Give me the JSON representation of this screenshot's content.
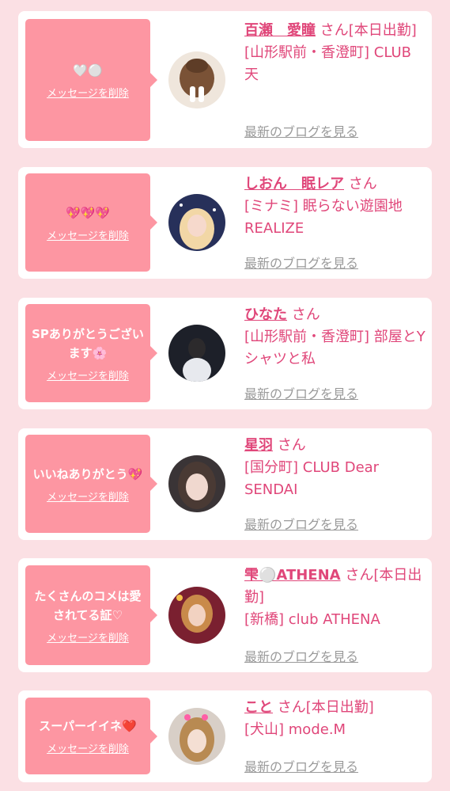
{
  "delete_label": "メッセージを削除",
  "blog_label": "最新のブログを見る",
  "colors": {
    "accent": "#e0477a",
    "bubble": "#fd96a2",
    "background": "#fbe0e4"
  },
  "cards": [
    {
      "message": "🤍⚪️",
      "name": "百瀬　愛瞳",
      "suffix": "さん[本日出勤]",
      "shop": "[山形駅前・香澄町] CLUB 天",
      "avatar_icon": "avatar-photo"
    },
    {
      "message": "💖💖💖",
      "name": "しおん　眠レア",
      "suffix": "さん",
      "shop": "[ミナミ] 眠らない遊園地REALIZE",
      "avatar_icon": "avatar-photo"
    },
    {
      "message": "SPありがとうございます🌸",
      "name": "ひなた",
      "suffix": "さん",
      "shop": "[山形駅前・香澄町] 部屋とYシャツと私",
      "avatar_icon": "avatar-photo"
    },
    {
      "message": "いいねありがとう💖",
      "name": "星羽",
      "suffix": "さん",
      "shop": "[国分町] CLUB Dear SENDAI",
      "avatar_icon": "avatar-photo"
    },
    {
      "message": "たくさんのコメは愛されてる証♡",
      "name": "雫⚪️ATHENA",
      "suffix": "さん[本日出勤]",
      "shop": "[新橋] club ATHENA",
      "avatar_icon": "avatar-photo"
    },
    {
      "message": "スーパーイイネ❤️",
      "name": "こと",
      "suffix": "さん[本日出勤]",
      "shop": "[犬山] mode.M",
      "avatar_icon": "avatar-photo"
    }
  ]
}
